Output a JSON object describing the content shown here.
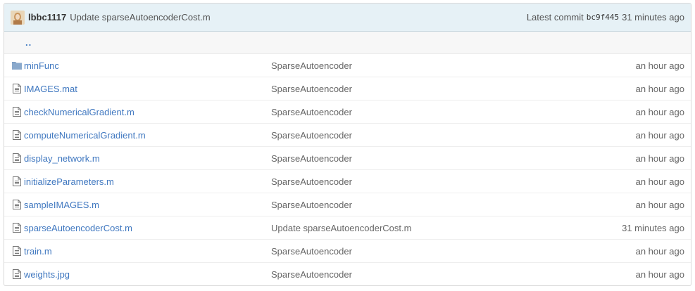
{
  "commit": {
    "author": "lbbc1117",
    "message": "Update sparseAutoencoderCost.m",
    "latest_label": "Latest commit",
    "sha": "bc9f445",
    "age": "31 minutes ago"
  },
  "parent_link": "..",
  "files": [
    {
      "type": "folder",
      "name": "minFunc",
      "message": "SparseAutoencoder",
      "age": "an hour ago"
    },
    {
      "type": "file",
      "name": "IMAGES.mat",
      "message": "SparseAutoencoder",
      "age": "an hour ago"
    },
    {
      "type": "file",
      "name": "checkNumericalGradient.m",
      "message": "SparseAutoencoder",
      "age": "an hour ago"
    },
    {
      "type": "file",
      "name": "computeNumericalGradient.m",
      "message": "SparseAutoencoder",
      "age": "an hour ago"
    },
    {
      "type": "file",
      "name": "display_network.m",
      "message": "SparseAutoencoder",
      "age": "an hour ago"
    },
    {
      "type": "file",
      "name": "initializeParameters.m",
      "message": "SparseAutoencoder",
      "age": "an hour ago"
    },
    {
      "type": "file",
      "name": "sampleIMAGES.m",
      "message": "SparseAutoencoder",
      "age": "an hour ago"
    },
    {
      "type": "file",
      "name": "sparseAutoencoderCost.m",
      "message": "Update sparseAutoencoderCost.m",
      "age": "31 minutes ago"
    },
    {
      "type": "file",
      "name": "train.m",
      "message": "SparseAutoencoder",
      "age": "an hour ago"
    },
    {
      "type": "file",
      "name": "weights.jpg",
      "message": "SparseAutoencoder",
      "age": "an hour ago"
    }
  ],
  "colors": {
    "link": "#4078c0",
    "commit_bar_bg": "#e6f1f6",
    "icon": "#767676"
  }
}
